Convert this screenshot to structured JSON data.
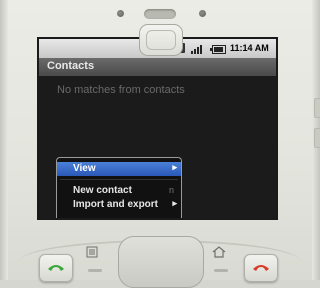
{
  "status_bar": {
    "notification_icon": "C",
    "time": "11:14 AM"
  },
  "app": {
    "title": "Contacts",
    "empty_message": "No matches from contacts"
  },
  "options_menu": {
    "items": [
      {
        "label": "View",
        "has_submenu": true,
        "highlighted": true
      },
      {
        "label": "New contact",
        "shortcut": "n"
      },
      {
        "label": "Import and export",
        "has_submenu": true
      }
    ]
  },
  "hardware_keys": [
    "call-icon",
    "menu-icon",
    "dpad",
    "home-icon",
    "end-call-icon"
  ],
  "colors": {
    "menu_highlight": "#3a6ccc",
    "call_green": "#3aa63a",
    "end_red": "#d83a2a"
  }
}
